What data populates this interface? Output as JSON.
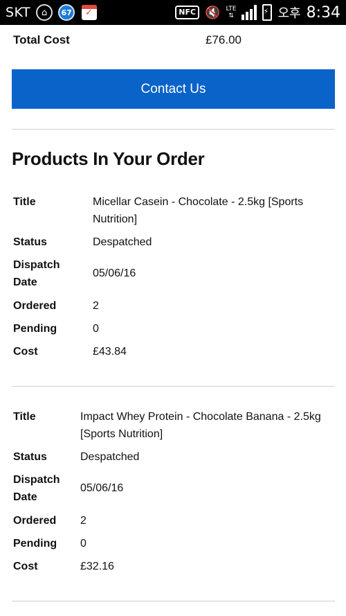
{
  "status_bar": {
    "carrier": "SKT",
    "badge_count": "67",
    "nfc_label": "NFC",
    "lte_label": "LTE",
    "ampm": "오후",
    "time": "8:34"
  },
  "order": {
    "total_cost_label": "Total Cost",
    "total_cost_value": "£76.00"
  },
  "contact_button_label": "Contact Us",
  "products_heading": "Products In Your Order",
  "field_labels": {
    "title": "Title",
    "status": "Status",
    "dispatch_date": "Dispatch Date",
    "ordered": "Ordered",
    "pending": "Pending",
    "cost": "Cost"
  },
  "products": [
    {
      "title": "Micellar Casein - Chocolate - 2.5kg [Sports Nutrition]",
      "status": "Despatched",
      "dispatch_date": "05/06/16",
      "ordered": "2",
      "pending": "0",
      "cost": "£43.84"
    },
    {
      "title": "Impact Whey Protein - Chocolate Banana - 2.5kg [Sports Nutrition]",
      "status": "Despatched",
      "dispatch_date": "05/06/16",
      "ordered": "2",
      "pending": "0",
      "cost": "£32.16"
    }
  ]
}
